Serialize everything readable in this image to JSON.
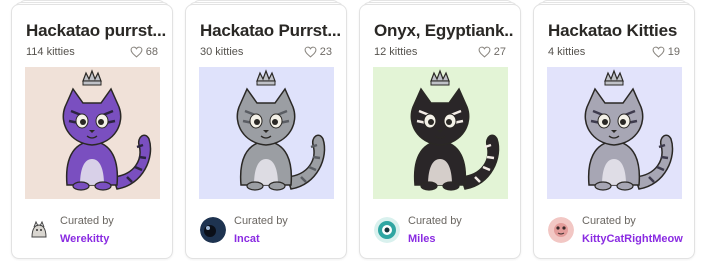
{
  "collections": [
    {
      "title": "Hackatao purrst...",
      "count": "114 kitties",
      "likes": "68",
      "bg": "#f0e1d8",
      "fur": "#7a4fc0",
      "stripe": "#2b2340",
      "curated_label": "Curated by",
      "curator": "Werekitty",
      "avatar_color": "#ffffff",
      "kitty_name": "purple-striped-kitty-icon"
    },
    {
      "title": "Hackatao Purrst...",
      "count": "30 kitties",
      "likes": "23",
      "bg": "#dfe2fb",
      "fur": "#9b9ea3",
      "stripe": "#5a5d63",
      "curated_label": "Curated by",
      "curator": "Incat",
      "avatar_color": "#1e3350",
      "kitty_name": "grey-kitty-icon"
    },
    {
      "title": "Onyx, Egyptiank...",
      "count": "12 kitties",
      "likes": "27",
      "bg": "#e3f4d6",
      "fur": "#2a2628",
      "stripe": "#f3ece6",
      "curated_label": "Curated by",
      "curator": "Miles",
      "avatar_color": "#2fa6a2",
      "kitty_name": "black-kitty-icon"
    },
    {
      "title": "Hackatao Kitties",
      "count": "4 kitties",
      "likes": "19",
      "bg": "#e2e3fb",
      "fur": "#a7a6b4",
      "stripe": "#3e3b4d",
      "curated_label": "Curated by",
      "curator": "KittyCatRightMeow",
      "avatar_color": "#f2c7c4",
      "kitty_name": "lavender-kitty-icon"
    }
  ],
  "accent": "#8a2be2"
}
